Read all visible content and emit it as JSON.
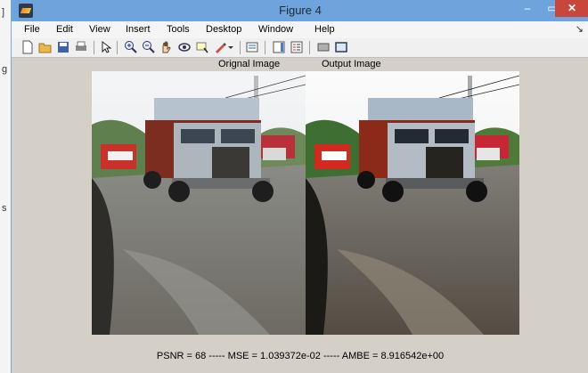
{
  "window": {
    "title": "Figure 4",
    "minimize_glyph": "–",
    "maximize_glyph": "▭",
    "close_glyph": "✕"
  },
  "menu": {
    "items": [
      "File",
      "Edit",
      "View",
      "Insert",
      "Tools",
      "Desktop",
      "Window",
      "Help"
    ],
    "overflow_glyph": "↘"
  },
  "toolbar": {
    "icons": [
      "new-figure-icon",
      "open-file-icon",
      "save-icon",
      "print-icon",
      "pointer-icon",
      "zoom-in-icon",
      "zoom-out-icon",
      "pan-icon",
      "rotate-icon",
      "data-cursor-icon",
      "brush-icon",
      "link-icon",
      "colorbar-icon",
      "legend-icon",
      "hide-plot-tools-icon",
      "show-plot-tools-icon"
    ]
  },
  "figure": {
    "left_caption": "Orignal Image",
    "right_caption": "Output Image",
    "metrics": "PSNR = 68 ----- MSE  = 1.039372e-02 ----- AMBE = 8.916542e+00"
  },
  "desktop_edge": {
    "chars": [
      "]",
      "g",
      "s"
    ]
  }
}
